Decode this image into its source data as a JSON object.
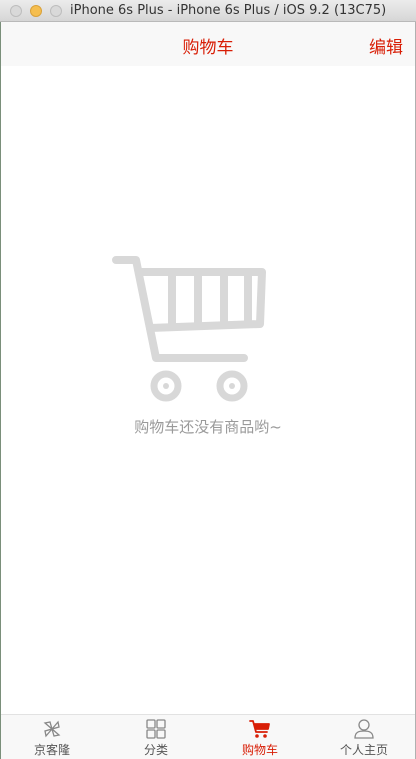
{
  "window": {
    "title": "iPhone 6s Plus - iPhone 6s Plus / iOS 9.2 (13C75)"
  },
  "navbar": {
    "title": "购物车",
    "edit_label": "编辑"
  },
  "content": {
    "empty_message": "购物车还没有商品哟~"
  },
  "tabbar": {
    "items": [
      {
        "label": "京客隆",
        "icon": "pinwheel-icon",
        "active": false
      },
      {
        "label": "分类",
        "icon": "grid-icon",
        "active": false
      },
      {
        "label": "购物车",
        "icon": "cart-icon",
        "active": true
      },
      {
        "label": "个人主页",
        "icon": "person-icon",
        "active": false
      }
    ]
  },
  "colors": {
    "accent": "#d81e06",
    "empty_icon": "#d8d8d8",
    "empty_text": "#9a9a9a",
    "tab_inactive": "#555555"
  }
}
